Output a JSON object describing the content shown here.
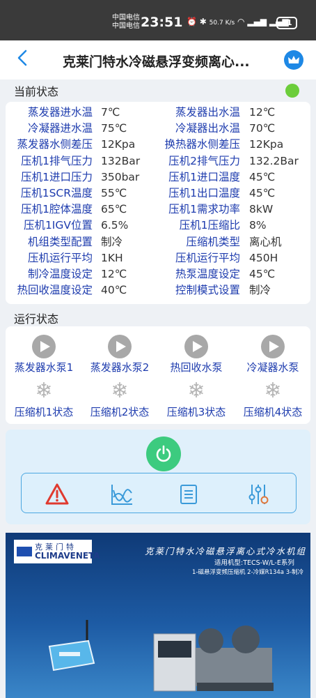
{
  "status_bar": {
    "carrier_1": "中国电信",
    "carrier_2": "中国电信",
    "time": "23:51",
    "net_speed": "50.7 K/s",
    "battery": "31"
  },
  "header": {
    "title": "克莱门特水冷磁悬浮变频离心..."
  },
  "current_status": {
    "heading": "当前状态",
    "indicator_color": "#6ccd3b",
    "rows": [
      {
        "l1": "蒸发器进水温",
        "v1": "7℃",
        "l2": "蒸发器出水温",
        "v2": "12℃"
      },
      {
        "l1": "冷凝器进水温",
        "v1": "75℃",
        "l2": "冷凝器出水温",
        "v2": "70℃"
      },
      {
        "l1": "蒸发器水侧差压",
        "v1": "12Kpa",
        "l2": "换热器水侧差压",
        "v2": "12Kpa"
      },
      {
        "l1": "压机1排气压力",
        "v1": "132Bar",
        "l2": "压机2排气压力",
        "v2": "132.2Bar"
      },
      {
        "l1": "压机1进口压力",
        "v1": "350bar",
        "l2": "压机1进口温度",
        "v2": "45℃"
      },
      {
        "l1": "压机1SCR温度",
        "v1": "55℃",
        "l2": "压机1出口温度",
        "v2": "45℃"
      },
      {
        "l1": "压机1腔体温度",
        "v1": "65℃",
        "l2": "压机1需求功率",
        "v2": "8kW"
      },
      {
        "l1": "压机1IGV位置",
        "v1": "6.5%",
        "l2": "压机1压缩比",
        "v2": "8%"
      },
      {
        "l1": "机组类型配置",
        "v1": "制冷",
        "l2": "压缩机类型",
        "v2": "离心机"
      },
      {
        "l1": "压机运行平均",
        "v1": "1KH",
        "l2": "压机运行平均",
        "v2": "450H"
      },
      {
        "l1": "制冷温度设定",
        "v1": "12℃",
        "l2": "热泵温度设定",
        "v2": "45℃"
      },
      {
        "l1": "热回收温度设定",
        "v1": "40℃",
        "l2": "控制模式设置",
        "v2": "制冷"
      }
    ]
  },
  "run_status": {
    "heading": "运行状态",
    "pumps": [
      "蒸发器水泵1",
      "蒸发器水泵2",
      "热回收水泵",
      "冷凝器水泵"
    ],
    "compressors": [
      "压缩机1状态",
      "压缩机2状态",
      "压缩机3状态",
      "压缩机4状态"
    ]
  },
  "controls": {
    "power_color": "#3ccb7f",
    "tools": [
      "alarm-icon",
      "trend-chart-icon",
      "list-icon",
      "settings-sliders-icon"
    ]
  },
  "banner": {
    "logo_cn": "克莱门特",
    "logo_en": "CLIMAVENETA",
    "title": "克莱门特水冷磁悬浮离心式冷水机组",
    "sub1": "适用机型:TECS-W/L-E系列",
    "sub2": "1-磁悬浮变频压缩机 2-冷媒R134a 3-制冷"
  }
}
